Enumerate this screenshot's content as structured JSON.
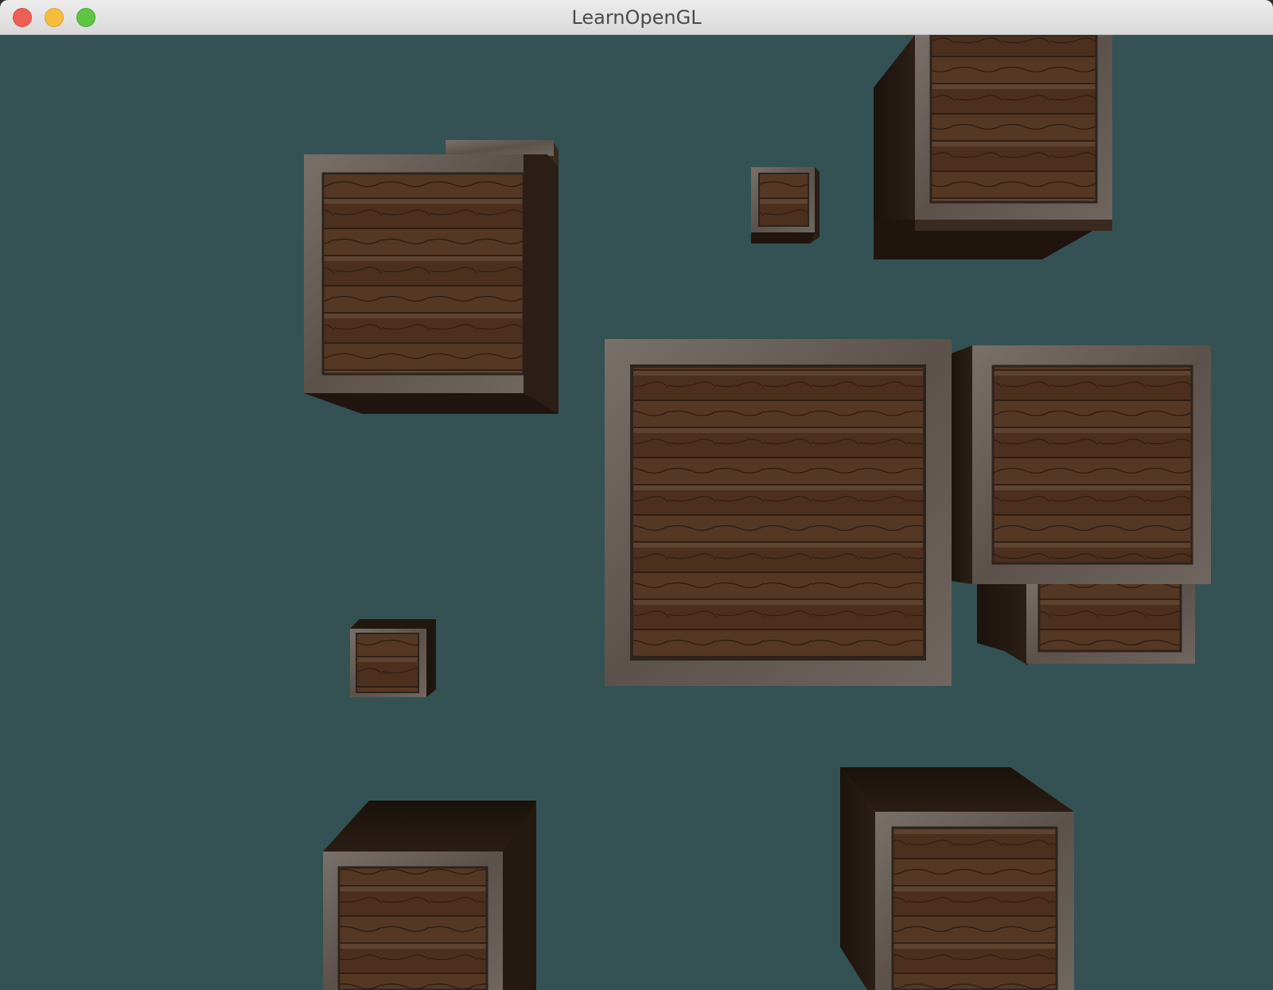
{
  "window": {
    "title": "LearnOpenGL",
    "controls": [
      "close",
      "minimize",
      "maximize"
    ]
  },
  "scene": {
    "clear_color": "#345253",
    "object": "wooden-crate",
    "crate_count": 10,
    "crate_wood_color": "#4a3020",
    "crate_frame_color": "#6e655e"
  }
}
